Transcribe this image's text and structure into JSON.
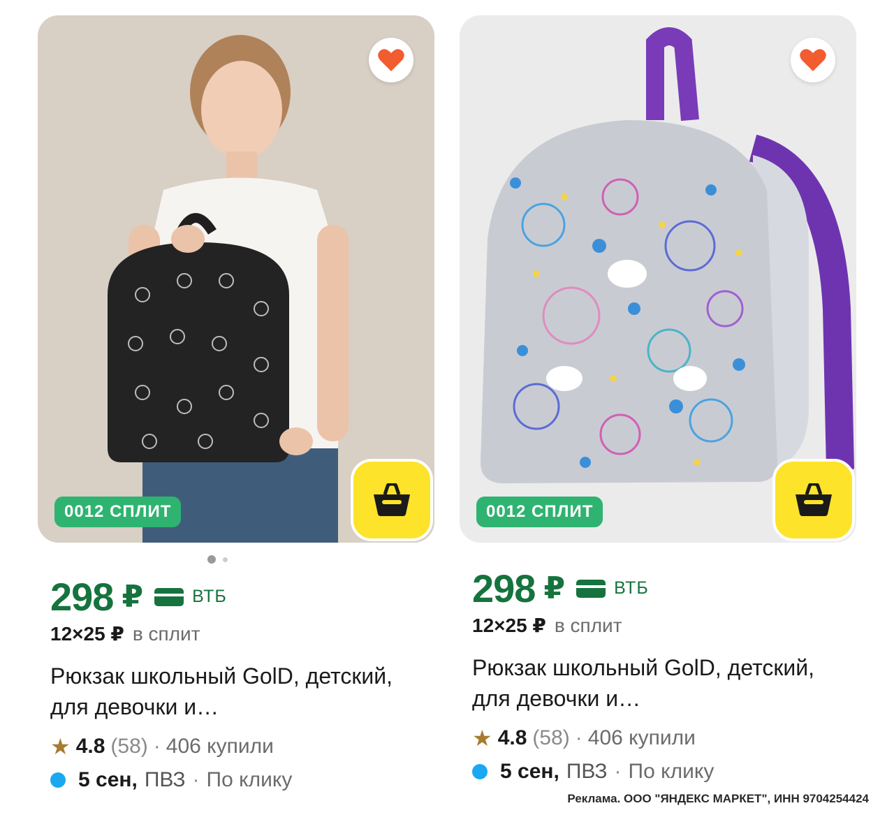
{
  "products": [
    {
      "split_badge": "0012 СПЛИТ",
      "price": "298",
      "currency": "₽",
      "bank": "ВТБ",
      "split_amount": "12×25 ₽",
      "split_text": "в сплит",
      "title": "Рюкзак школьный GolD, детский, для девочки и…",
      "rating": "4.8",
      "reviews": "(58)",
      "bought": "406 купили",
      "delivery_date": "5 сен,",
      "pickup": "ПВЗ",
      "delivery_option": "По клику",
      "gallery_dots": 2
    },
    {
      "split_badge": "0012 СПЛИТ",
      "price": "298",
      "currency": "₽",
      "bank": "ВТБ",
      "split_amount": "12×25 ₽",
      "split_text": "в сплит",
      "title": "Рюкзак школьный GolD, детский, для девочки и…",
      "rating": "4.8",
      "reviews": "(58)",
      "bought": "406 купили",
      "delivery_date": "5 сен,",
      "pickup": "ПВЗ",
      "delivery_option": "По клику"
    }
  ],
  "separator": "·",
  "ad_footer": "Реклама. ООО \"ЯНДЕКС МАРКЕТ\", ИНН 9704254424",
  "colors": {
    "price_green": "#16733e",
    "split_badge_green": "#2fb371",
    "cart_yellow": "#fde32a",
    "favorite_heart": "#f25c2f",
    "delivery_dot": "#1aa9f0",
    "star": "#a67c2f"
  },
  "icons": {
    "favorite": "heart-icon",
    "cart": "basket-icon",
    "bank_card": "card-icon",
    "rating": "star-icon",
    "delivery": "dot-icon"
  }
}
